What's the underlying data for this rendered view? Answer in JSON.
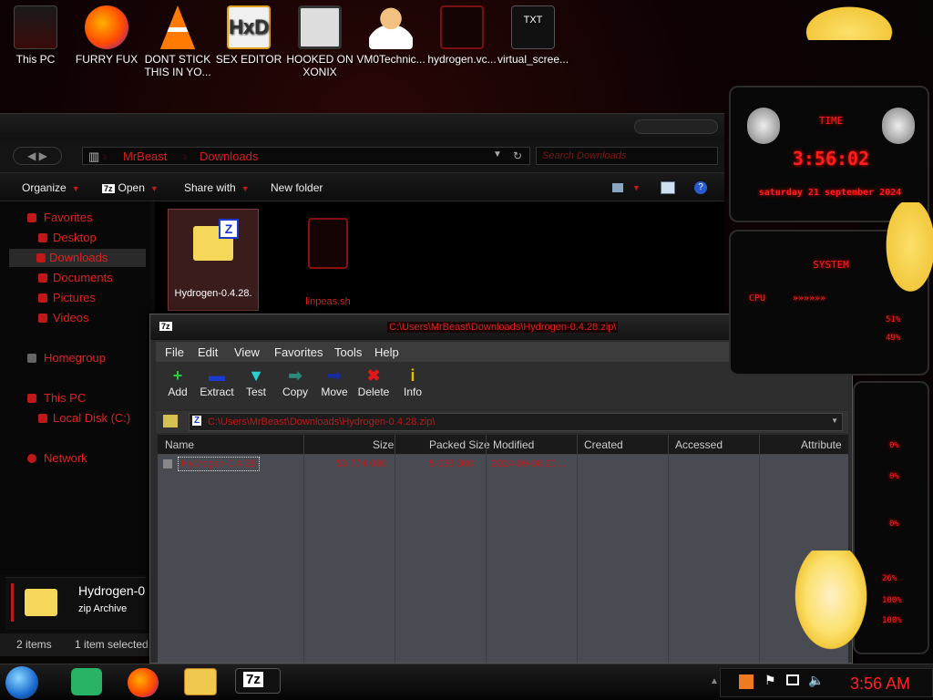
{
  "desktop": {
    "icons": [
      {
        "label": "This PC"
      },
      {
        "label": "FURRY FUX"
      },
      {
        "label": "DONT STICK THIS IN YO..."
      },
      {
        "label": "SEX EDITOR"
      },
      {
        "label": "HOOKED ON XONIX"
      },
      {
        "label": "VM0Technic..."
      },
      {
        "label": "hydrogen.vc..."
      },
      {
        "label": "virtual_scree..."
      }
    ]
  },
  "explorer": {
    "breadcrumb": [
      "MrBeast",
      "Downloads"
    ],
    "search_placeholder": "Search Downloads",
    "commands": {
      "organize": "Organize",
      "open": "Open",
      "share": "Share with",
      "new_folder": "New folder"
    },
    "nav": {
      "favorites": "Favorites",
      "desktop": "Desktop",
      "downloads": "Downloads",
      "documents": "Documents",
      "pictures": "Pictures",
      "videos": "Videos",
      "homegroup": "Homegroup",
      "this_pc": "This PC",
      "local_disk": "Local Disk (C:)",
      "network": "Network"
    },
    "files": [
      {
        "name": "Hydrogen-0.4.28."
      },
      {
        "name": "linpeas.sh"
      }
    ],
    "details": {
      "name": "Hydrogen-0",
      "type": "zip Archive"
    },
    "status": {
      "items": "2 items",
      "selected": "1 item selected"
    }
  },
  "zip": {
    "title": "C:\\Users\\MrBeast\\Downloads\\Hydrogen-0.4.28.zip\\",
    "menu": [
      "File",
      "Edit",
      "View",
      "Favorites",
      "Tools",
      "Help"
    ],
    "tools": [
      {
        "label": "Add",
        "glyph": "+",
        "color": "#2ecc40"
      },
      {
        "label": "Extract",
        "glyph": "▬",
        "color": "#1a3ad0"
      },
      {
        "label": "Test",
        "glyph": "▼",
        "color": "#28d0d0"
      },
      {
        "label": "Copy",
        "glyph": "➡",
        "color": "#2a8a7a"
      },
      {
        "label": "Move",
        "glyph": "➡",
        "color": "#1a2aa0"
      },
      {
        "label": "Delete",
        "glyph": "✖",
        "color": "#e01818"
      },
      {
        "label": "Info",
        "glyph": "i",
        "color": "#e0c000"
      }
    ],
    "path": "C:\\Users\\MrBeast\\Downloads\\Hydrogen-0.4.28.zip\\",
    "columns": [
      "Name",
      "Size",
      "Packed Size",
      "Modified",
      "Created",
      "Accessed",
      "Attribute"
    ],
    "rows": [
      {
        "name": "Hydrogen-0.4.28",
        "size": "53 774 080",
        "packed": "5 038 300",
        "modified": "2024-09-06 20:..."
      }
    ]
  },
  "widgets": {
    "time_label": "TIME",
    "time": "3:56:02",
    "date": "saturday 21 september 2024",
    "system_label": "SYSTEM",
    "cpu_label": "CPU",
    "pct": [
      "51%",
      "49%",
      "0%",
      "0%",
      "0%",
      "26%",
      "100%",
      "100%"
    ]
  },
  "taskbar": {
    "clock": "3:56 AM",
    "zip_label": "7z"
  }
}
